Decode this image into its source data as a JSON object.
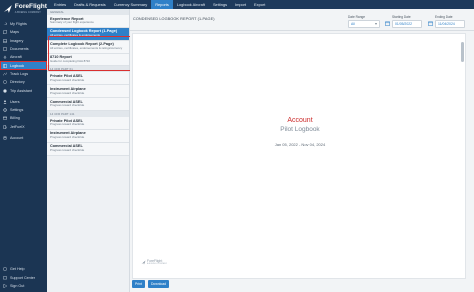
{
  "brand": {
    "name": "ForeFlight",
    "sub": "A BOEING COMPANY"
  },
  "sidebar": {
    "top_items": [
      {
        "label": "My Flights",
        "icon": "plane-icon"
      },
      {
        "label": "Maps",
        "icon": "map-icon"
      },
      {
        "label": "Imagery",
        "icon": "image-icon"
      },
      {
        "label": "Documents",
        "icon": "document-icon"
      },
      {
        "label": "Aircraft",
        "icon": "aircraft-icon"
      },
      {
        "label": "Logbook",
        "icon": "book-icon",
        "active": true
      },
      {
        "label": "Track Logs",
        "icon": "track-icon"
      },
      {
        "label": "Directory",
        "icon": "directory-icon"
      },
      {
        "label": "Trip Assistant",
        "icon": "assistant-icon"
      }
    ],
    "mid_items": [
      {
        "label": "Users",
        "icon": "users-icon"
      },
      {
        "label": "Settings",
        "icon": "gear-icon"
      },
      {
        "label": "Billing",
        "icon": "billing-icon"
      },
      {
        "label": "JetFuelX",
        "icon": "fuel-icon"
      }
    ],
    "account_item": {
      "label": "Account",
      "icon": "account-icon"
    },
    "bottom_items": [
      {
        "label": "Get Help",
        "icon": "help-icon"
      },
      {
        "label": "Support Center",
        "icon": "support-icon"
      },
      {
        "label": "Sign Out",
        "icon": "sign-out-icon"
      }
    ]
  },
  "tabs": [
    {
      "label": "Entries"
    },
    {
      "label": "Drafts & Requests"
    },
    {
      "label": "Currency Summary"
    },
    {
      "label": "Reports",
      "active": true
    },
    {
      "label": "Logbook Aircraft"
    },
    {
      "label": "Settings"
    },
    {
      "label": "Import"
    },
    {
      "label": "Export"
    }
  ],
  "report_groups": [
    {
      "header": "GENERAL",
      "items": [
        {
          "title": "Experience Report",
          "desc": "Summary of your flight experience"
        },
        {
          "title": "Condensed Logbook Report (1-Page)",
          "desc": "All entries, certificates & endorsements",
          "selected": true
        },
        {
          "title": "Complete Logbook Report (2-Page)",
          "desc": "All entries, certificates, endorsements & ratings/currency"
        },
        {
          "title": "8710 Report",
          "desc": "Guide for completing FAA 8710"
        }
      ]
    },
    {
      "header": "14 CFR PART 61",
      "items": [
        {
          "title": "Private Pilot ASEL",
          "desc": "Progress toward checkride"
        },
        {
          "title": "Instrument Airplane",
          "desc": "Progress toward checkride"
        },
        {
          "title": "Commercial ASEL",
          "desc": "Progress toward checkride"
        }
      ]
    },
    {
      "header": "14 CFR PART 141",
      "items": [
        {
          "title": "Private Pilot ASEL",
          "desc": "Progress toward checkride"
        },
        {
          "title": "Instrument Airplane",
          "desc": "Progress toward checkride"
        },
        {
          "title": "Commercial ASEL",
          "desc": "Progress toward checkride"
        }
      ]
    }
  ],
  "main": {
    "report_title": "CONDENSED LOGBOOK REPORT (1-PAGE)",
    "date_range": {
      "label": "Date Range",
      "value": "All"
    },
    "starting_date": {
      "label": "Starting Date",
      "value": "01/05/2022"
    },
    "ending_date": {
      "label": "Ending Date",
      "value": "11/04/2024"
    }
  },
  "document": {
    "account": "Account",
    "title": "Pilot Logbook",
    "range": "Jan 05, 2022 - Nov 04, 2024",
    "footer_name": "ForeFlight",
    "footer_sub": "A BOEING COMPANY"
  },
  "buttons": {
    "print": "Print",
    "download": "Download"
  },
  "colors": {
    "sidebar": "#1b3553",
    "accent": "#2f80c8",
    "highlight": "#d93030",
    "account_text": "#cc2b2b"
  }
}
